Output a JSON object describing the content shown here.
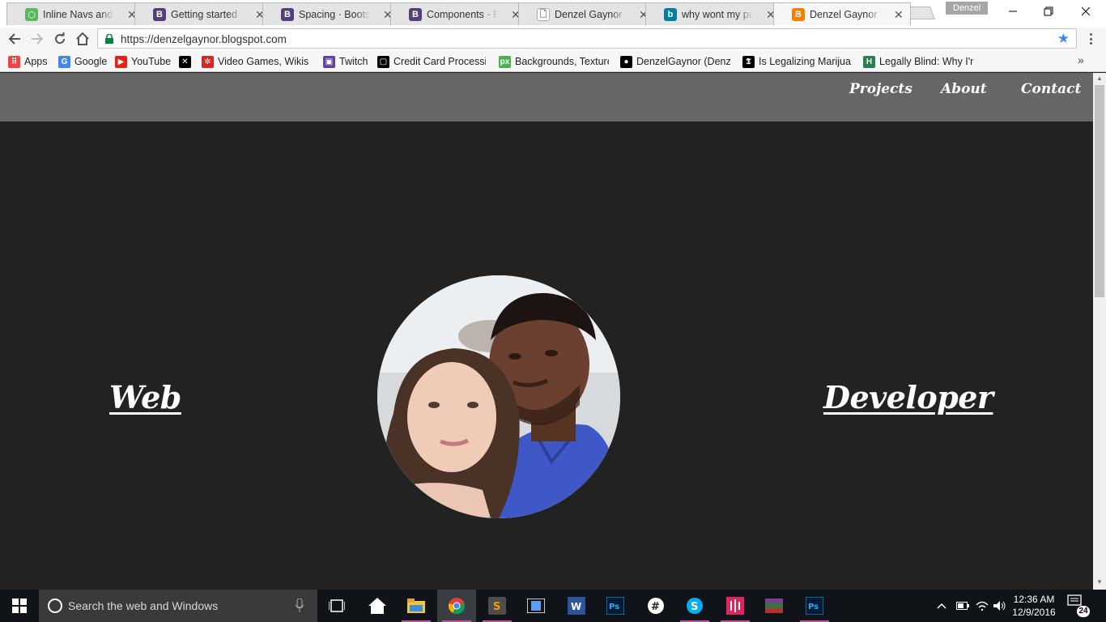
{
  "browser": {
    "tabs": [
      {
        "title": "Inline Navs and Dropdowns",
        "favicon_color": "#5cb85c",
        "favicon": "⬡"
      },
      {
        "title": "Getting started · Bootstrap",
        "favicon_color": "#563d7c",
        "favicon": "B"
      },
      {
        "title": "Spacing · Bootstrap",
        "favicon_color": "#563d7c",
        "favicon": "B"
      },
      {
        "title": "Components · Bootstrap",
        "favicon_color": "#563d7c",
        "favicon": "B"
      },
      {
        "title": "Denzel Gaynor | Denzel",
        "favicon_color": "#ffffff",
        "favicon": "🗋"
      },
      {
        "title": "why wont my padding",
        "favicon_color": "#00809d",
        "favicon": "b"
      },
      {
        "title": "Denzel Gaynor | Denzel",
        "favicon_color": "#f57d00",
        "favicon": "B"
      }
    ],
    "active_tab_index": 6,
    "profile_name": "Denzel",
    "url": "https://denzelgaynor.blogspot.com",
    "bookmarks": [
      {
        "label": "Apps",
        "icon": "apps-grid-icon",
        "color": "#e44"
      },
      {
        "label": "Google",
        "icon": "google-icon",
        "color": "#4285f4"
      },
      {
        "label": "YouTube",
        "icon": "youtube-icon",
        "color": "#e62117"
      },
      {
        "label": "",
        "icon": "x-icon",
        "color": "#000000"
      },
      {
        "label": "Video Games, Wikis, Cheats",
        "icon": "gear-red-icon",
        "color": "#d22"
      },
      {
        "label": "Twitch",
        "icon": "twitch-icon",
        "color": "#6441a5"
      },
      {
        "label": "Credit Card Processing",
        "icon": "square-icon",
        "color": "#000000"
      },
      {
        "label": "Backgrounds, Textures",
        "icon": "px-icon",
        "color": "#4caf50"
      },
      {
        "label": "DenzelGaynor (Denzel",
        "icon": "github-icon",
        "color": "#000000"
      },
      {
        "label": "Is Legalizing Marijuana",
        "icon": "nyt-icon",
        "color": "#000000"
      },
      {
        "label": "Legally Blind: Why I'm",
        "icon": "h-icon",
        "color": "#2e7d4f"
      }
    ]
  },
  "site": {
    "nav": {
      "projects": "Projects",
      "about": "About",
      "contact": "Contact"
    },
    "hero": {
      "left_word": "Web",
      "right_word": "Developer",
      "photo_alt": "Portrait of couple"
    },
    "colors": {
      "nav_bg": "#666666",
      "page_bg": "#222222",
      "text": "#ffffff"
    }
  },
  "taskbar": {
    "search_placeholder": "Search the web and Windows",
    "time": "12:36 AM",
    "date": "12/9/2016",
    "notification_count": "24"
  }
}
